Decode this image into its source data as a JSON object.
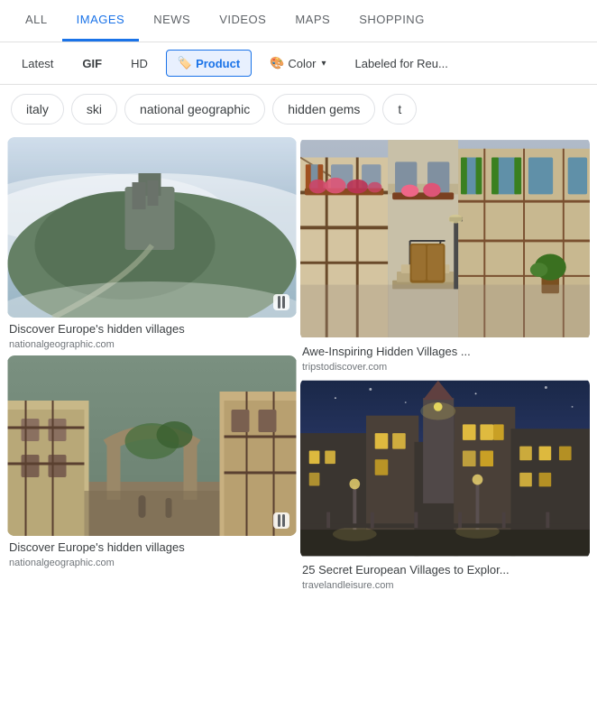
{
  "nav": {
    "tabs": [
      {
        "id": "all",
        "label": "ALL",
        "active": false
      },
      {
        "id": "images",
        "label": "IMAGES",
        "active": true
      },
      {
        "id": "news",
        "label": "NEWS",
        "active": false
      },
      {
        "id": "videos",
        "label": "VIDEOS",
        "active": false
      },
      {
        "id": "maps",
        "label": "MAPS",
        "active": false
      },
      {
        "id": "shopping",
        "label": "SHOPPING",
        "active": false
      }
    ]
  },
  "filters": {
    "items": [
      {
        "id": "latest",
        "label": "Latest",
        "icon": "",
        "active": false
      },
      {
        "id": "gif",
        "label": "GIF",
        "icon": "",
        "active": false
      },
      {
        "id": "hd",
        "label": "HD",
        "icon": "",
        "active": false
      },
      {
        "id": "product",
        "label": "Product",
        "icon": "🏷️",
        "active": true
      },
      {
        "id": "color",
        "label": "Color",
        "icon": "🎨",
        "active": false,
        "hasDropdown": true
      },
      {
        "id": "labeled",
        "label": "Labeled for Reu...",
        "icon": "",
        "active": false
      }
    ]
  },
  "chips": [
    {
      "id": "italy",
      "label": "italy"
    },
    {
      "id": "ski",
      "label": "ski"
    },
    {
      "id": "national-geographic",
      "label": "national geographic"
    },
    {
      "id": "hidden-gems",
      "label": "hidden gems"
    },
    {
      "id": "more",
      "label": "t"
    }
  ],
  "images": {
    "col1": [
      {
        "id": "img1",
        "title": "Discover Europe's hidden villages",
        "source": "nationalgeographic.com",
        "hasSlideshow": true,
        "colors": [
          "#b8c8d8",
          "#7a9bb5",
          "#5b8a6e",
          "#4a7060"
        ]
      },
      {
        "id": "img3",
        "title": "Discover Europe's hidden villages",
        "source": "nationalgeographic.com",
        "hasSlideshow": true,
        "colors": [
          "#7a9080",
          "#c8b888",
          "#906840",
          "#5a5040"
        ]
      }
    ],
    "col2": [
      {
        "id": "img2",
        "title": "Awe-Inspiring Hidden Villages ...",
        "source": "tripstodiscover.com",
        "hasSlideshow": false,
        "colors": [
          "#c8b090",
          "#d4a870",
          "#a89060",
          "#7a6840"
        ]
      },
      {
        "id": "img4",
        "title": "25 Secret European Villages to Explor...",
        "source": "travelandleisure.com",
        "hasSlideshow": false,
        "colors": [
          "#1a2040",
          "#2a3060",
          "#404878",
          "#c0a850"
        ]
      }
    ]
  }
}
